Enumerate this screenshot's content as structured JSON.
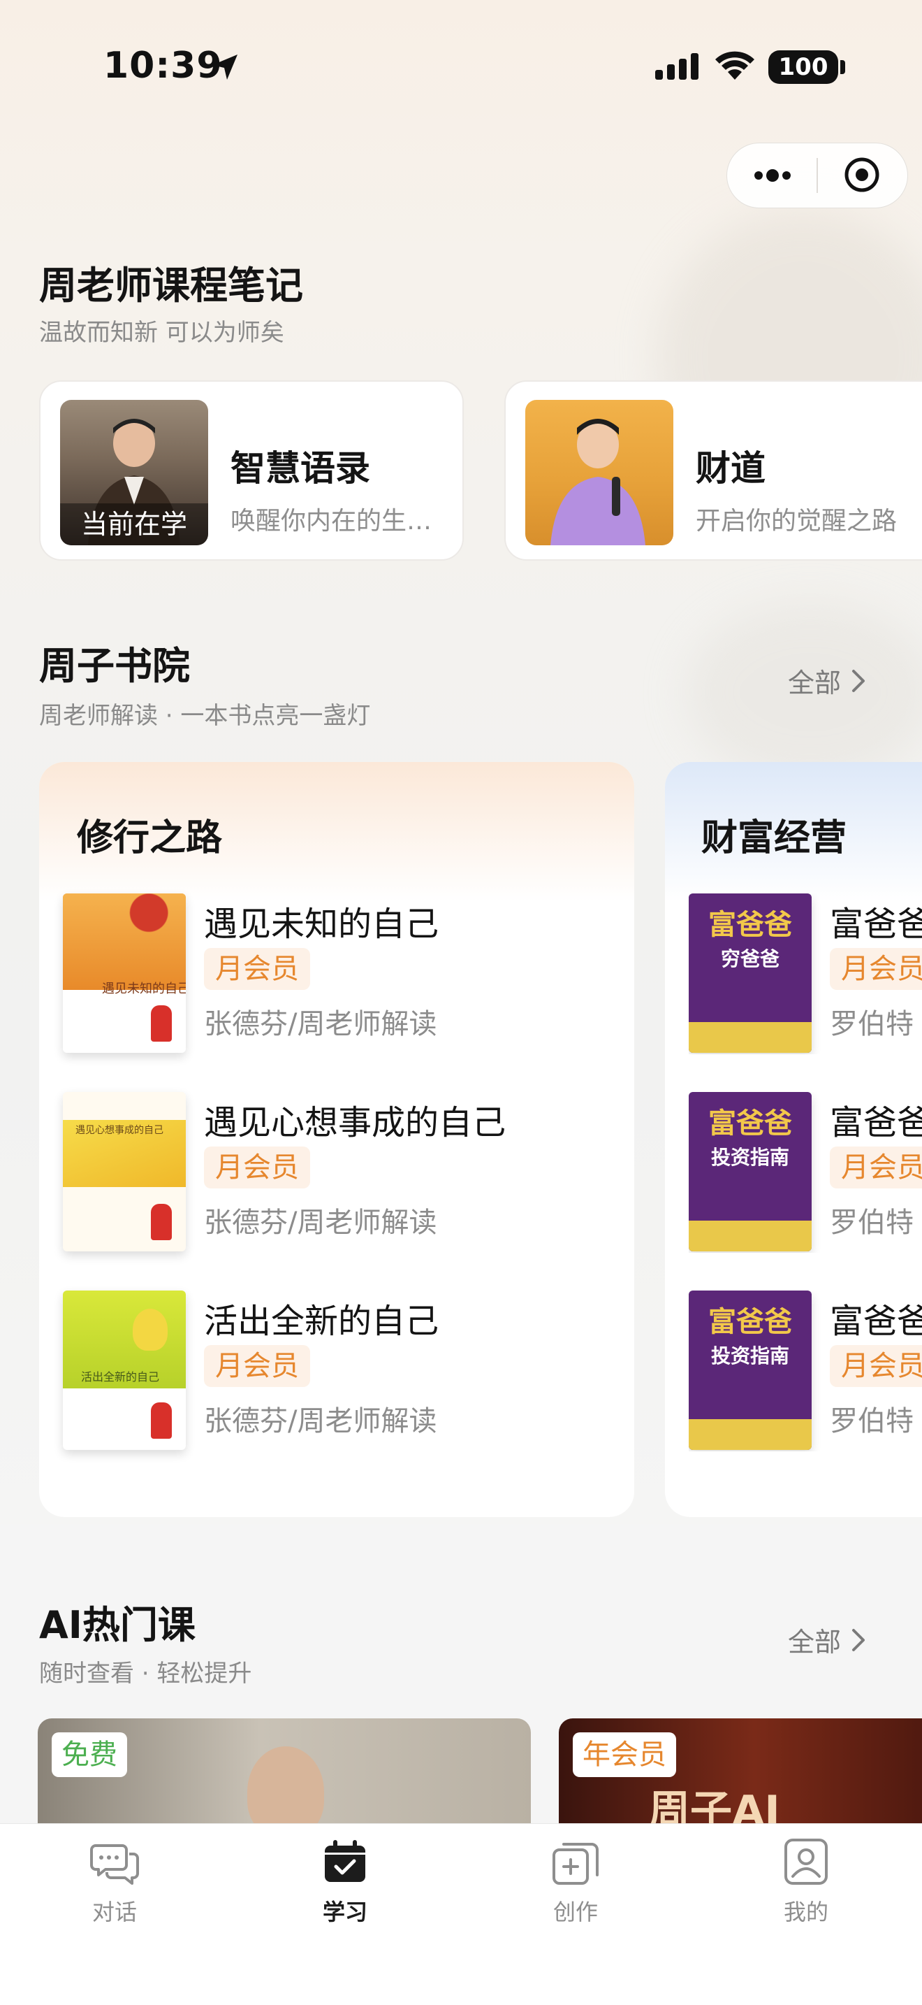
{
  "status_bar": {
    "time": "10:39",
    "battery": "100"
  },
  "header": {
    "more_icon": "more-dots-icon",
    "close_icon": "target-circle-icon"
  },
  "notes_section": {
    "title": "周老师课程笔记",
    "subtitle": "温故而知新 可以为师矣",
    "courses": [
      {
        "name": "智慧语录",
        "desc": "唤醒你内在的生…",
        "tag": "当前在学"
      },
      {
        "name": "财道",
        "desc": "开启你的觉醒之路"
      }
    ]
  },
  "academy_section": {
    "title": "周子书院",
    "subtitle": "周老师解读 · 一本书点亮一盏灯",
    "see_all": "全部",
    "categories": [
      {
        "title": "修行之路",
        "books": [
          {
            "name": "遇见未知的自己",
            "tag": "月会员",
            "author": "张德芬/周老师解读"
          },
          {
            "name": "遇见心想事成的自己",
            "tag": "月会员",
            "author": "张德芬/周老师解读"
          },
          {
            "name": "活出全新的自己",
            "tag": "月会员",
            "author": "张德芬/周老师解读"
          }
        ]
      },
      {
        "title": "财富经营",
        "books": [
          {
            "name": "富爸爸",
            "tag": "月会员",
            "author": "罗伯特"
          },
          {
            "name": "富爸爸",
            "tag": "月会员",
            "author": "罗伯特"
          },
          {
            "name": "富爸爸",
            "tag": "月会员",
            "author": "罗伯特"
          }
        ]
      }
    ],
    "covers": {
      "book1": "遇见未知的自己",
      "book2": "遇见心想事成的自己",
      "book3": "活出全新的自己",
      "rich1_title": "富爸爸",
      "rich1_sub": "穷爸爸",
      "rich2_title": "富爸爸",
      "rich2_sub": "投资指南",
      "rich3_title": "富爸爸",
      "rich3_sub": "投资指南"
    }
  },
  "ai_section": {
    "title": "AI热门课",
    "subtitle": "随时查看 · 轻松提升",
    "see_all": "全部",
    "cards": [
      {
        "tag": "免费",
        "tag_color": "#4caf50"
      },
      {
        "tag": "年会员",
        "tag_color": "#e6872e",
        "banner": "周子AI"
      }
    ]
  },
  "tabbar": {
    "items": [
      {
        "label": "对话",
        "icon": "chat-bubbles-icon"
      },
      {
        "label": "学习",
        "icon": "calendar-check-icon"
      },
      {
        "label": "创作",
        "icon": "create-cards-icon"
      },
      {
        "label": "我的",
        "icon": "profile-icon"
      }
    ],
    "active_index": 1
  },
  "colors": {
    "accent_orange": "#e6872e",
    "free_green": "#4caf50",
    "text_primary": "#141414",
    "text_secondary": "#8a8a8a"
  }
}
